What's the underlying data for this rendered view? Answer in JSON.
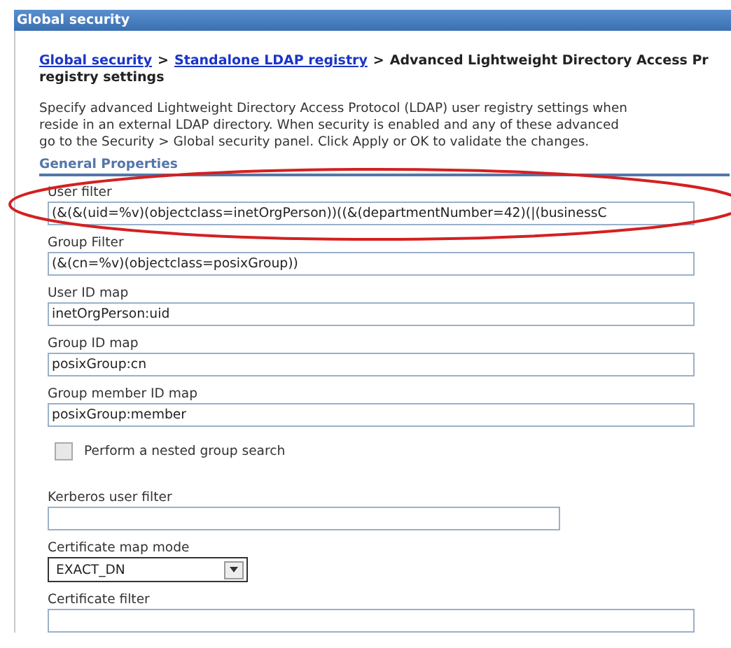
{
  "window": {
    "title": "Global security"
  },
  "breadcrumb": {
    "links": [
      "Global security",
      "Standalone LDAP registry"
    ],
    "separator": ">",
    "current": "Advanced Lightweight Directory Access Pr",
    "current_line2": "registry settings"
  },
  "description": [
    "Specify advanced Lightweight Directory Access Protocol (LDAP) user registry settings when",
    "reside in an external LDAP directory. When security is enabled and any of these advanced",
    "go to the Security > Global security panel. Click Apply or OK to validate the changes."
  ],
  "section": {
    "title": "General Properties"
  },
  "fields": [
    {
      "kind": "text",
      "label": "User filter",
      "value": "(&(&(uid=%v)(objectclass=inetOrgPerson))((&(departmentNumber=42)(|(businessC",
      "highlighted": true
    },
    {
      "kind": "text",
      "label": "Group Filter",
      "value": "(&(cn=%v)(objectclass=posixGroup))"
    },
    {
      "kind": "text",
      "label": "User ID map",
      "value": "inetOrgPerson:uid"
    },
    {
      "kind": "text",
      "label": "Group ID map",
      "value": "posixGroup:cn"
    },
    {
      "kind": "text",
      "label": "Group member ID map",
      "value": "posixGroup:member"
    },
    {
      "kind": "checkbox",
      "label": "Perform a nested group search",
      "checked": false
    },
    {
      "kind": "short",
      "label": "Kerberos user filter"
    },
    {
      "kind": "select",
      "label": "Certificate map mode",
      "value": "EXACT_DN"
    },
    {
      "kind": "text",
      "label": "Certificate filter"
    }
  ]
}
